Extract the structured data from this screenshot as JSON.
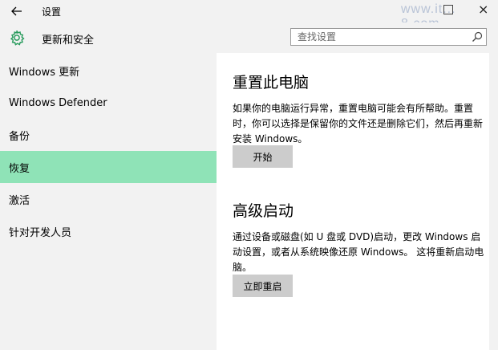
{
  "window": {
    "title": "设置",
    "watermark": "www.it... 8.com",
    "close_glyph": "×"
  },
  "header": {
    "icon": "gear-icon",
    "title": "更新和安全",
    "search_placeholder": "查找设置"
  },
  "sidebar": {
    "active_index": 3,
    "items": [
      {
        "label": "Windows 更新"
      },
      {
        "label": "Windows Defender"
      },
      {
        "label": "备份"
      },
      {
        "label": "恢复"
      },
      {
        "label": "激活"
      },
      {
        "label": "针对开发人员"
      }
    ]
  },
  "main": {
    "reset": {
      "heading": "重置此电脑",
      "description": "如果你的电脑运行异常，重置电脑可能会有所帮助。重置时，你可以选择是保留你的文件还是删除它们，然后再重新安装 Windows。",
      "button": "开始"
    },
    "advanced": {
      "heading": "高级启动",
      "description": "通过设备或磁盘(如 U 盘或 DVD)启动，更改 Windows 启动设置，或者从系统映像还原 Windows。 这将重新启动电脑。",
      "button": "立即重启"
    }
  },
  "colors": {
    "accent": "#2a9c5e",
    "active_nav": "#8fe3b7",
    "chrome": "#f2f2f2",
    "button": "#cccccc"
  }
}
